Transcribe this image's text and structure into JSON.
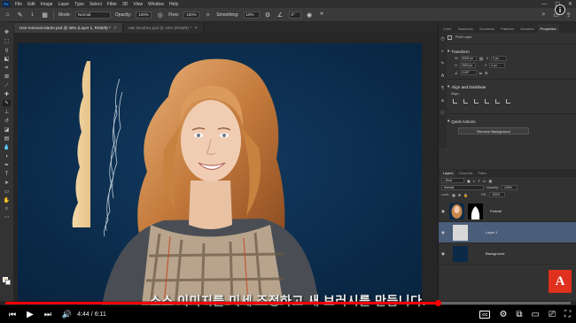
{
  "menubar": {
    "logo": "Ps",
    "items": [
      "File",
      "Edit",
      "Image",
      "Layer",
      "Type",
      "Select",
      "Filter",
      "3D",
      "View",
      "Window",
      "Help"
    ]
  },
  "options_bar": {
    "mode_label": "Mode:",
    "mode_value": "Normal",
    "opacity_label": "Opacity:",
    "opacity_value": "100%",
    "flow_label": "Flow:",
    "flow_value": "100%",
    "smoothing_label": "Smoothing:",
    "smoothing_value": "10%",
    "angle_value": "0°",
    "brush_size": "1"
  },
  "doc_tabs": [
    {
      "label": "Hair-removal-starter.psd @ 49% (Layer 1, RGB/8) *",
      "active": true
    },
    {
      "label": "Hair Brushes.psd @ 16% (RGB/8) *",
      "active": false
    }
  ],
  "properties_tabs": [
    "Color",
    "Swatches",
    "Gradients",
    "Patterns",
    "Libraries",
    "Properties"
  ],
  "properties": {
    "layer_kind": "Pixel Layer",
    "transform_header": "Transform",
    "w_label": "W",
    "w_value": "2000 px",
    "h_label": "H",
    "h_value": "2000 px",
    "x_label": "X",
    "x_value": "0 px",
    "y_label": "Y",
    "y_value": "0 px",
    "angle_value": "0.00°",
    "align_header": "Align and Distribute",
    "align_label": "Align:",
    "quick_actions_header": "Quick Actions",
    "remove_bg_button": "Remove Background"
  },
  "layers_panel": {
    "tabs": [
      "Layers",
      "Channels",
      "Paths"
    ],
    "kind_filter": "Kind",
    "blend_mode": "Normal",
    "opacity_label": "Opacity:",
    "opacity_value": "100%",
    "lock_label": "Lock:",
    "fill_label": "Fill:",
    "fill_value": "100%",
    "layers": [
      {
        "name": "Portrait",
        "active": false
      },
      {
        "name": "Layer 1",
        "active": true
      },
      {
        "name": "Background",
        "active": false
      }
    ]
  },
  "video": {
    "subtitle": "소스 이미지를 미세 조정하고 새 브러시를 만듭니다.",
    "current_time": "4:44",
    "duration": "6:11",
    "progress": 0.766,
    "channel_logo": "A",
    "cc_label": "CC",
    "info_label": "i"
  },
  "colors": {
    "canvas_bg": "#0b2a48",
    "progress_red": "#ff0000",
    "active_layer": "#4a5e7a",
    "brand_red": "#e0311f"
  }
}
